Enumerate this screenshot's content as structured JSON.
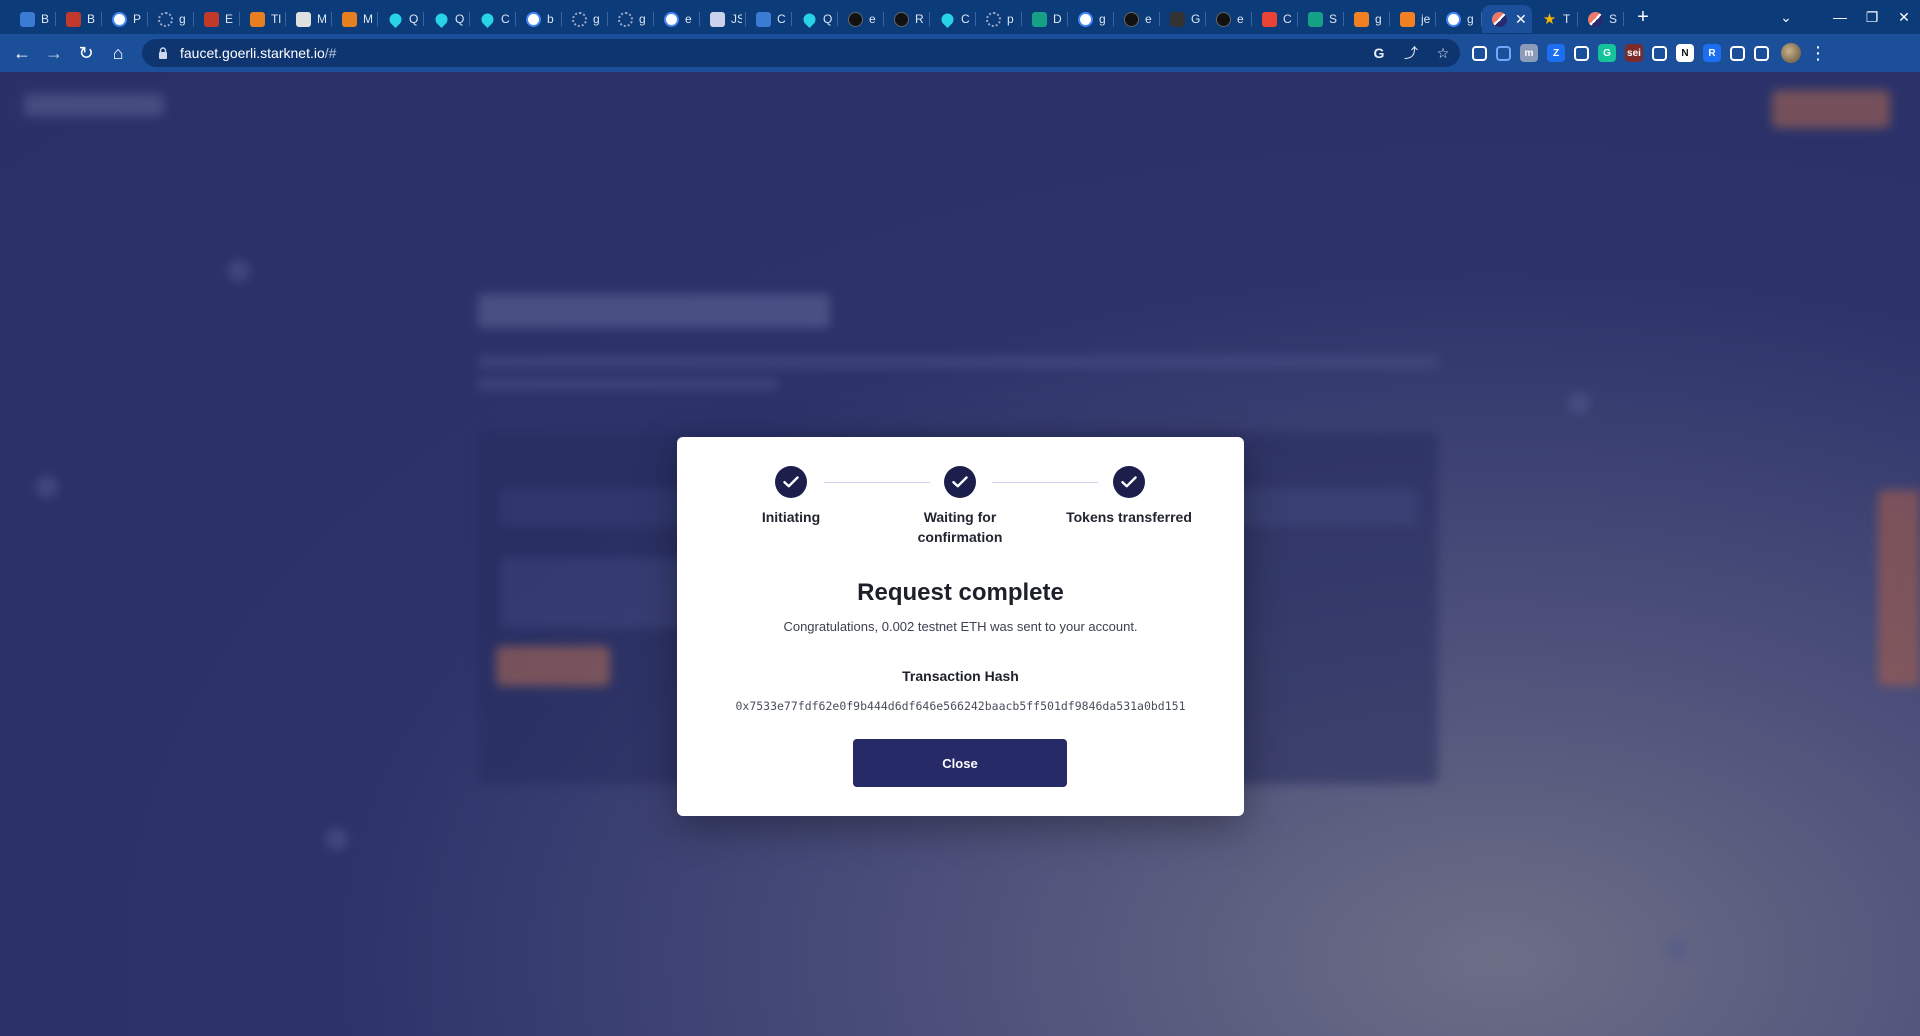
{
  "browser": {
    "tabs": [
      {
        "title": "B",
        "icon": "diamond-icon",
        "color": "#3a7bd5"
      },
      {
        "title": "B",
        "icon": "circle-icon",
        "color": "#c0392b"
      },
      {
        "title": "P",
        "icon": "google-icon",
        "color": "#ffffff"
      },
      {
        "title": "g",
        "icon": "sun-icon",
        "color": "#9aa7c7"
      },
      {
        "title": "E",
        "icon": "circle-icon",
        "color": "#c0392b"
      },
      {
        "title": "Tl",
        "icon": "fox-icon",
        "color": "#e67e22"
      },
      {
        "title": "M",
        "icon": "mail-icon",
        "color": "#e0e0e0"
      },
      {
        "title": "M",
        "icon": "fox-icon",
        "color": "#e67e22"
      },
      {
        "title": "Q",
        "icon": "drop-icon",
        "color": "#29d3e6"
      },
      {
        "title": "Q",
        "icon": "drop-icon",
        "color": "#29d3e6"
      },
      {
        "title": "C",
        "icon": "drop-icon",
        "color": "#29d3e6"
      },
      {
        "title": "b",
        "icon": "google-icon",
        "color": "#ffffff"
      },
      {
        "title": "g",
        "icon": "sun-icon",
        "color": "#9aa7c7"
      },
      {
        "title": "g",
        "icon": "sun-icon",
        "color": "#9aa7c7"
      },
      {
        "title": "e",
        "icon": "google-icon",
        "color": "#ffffff"
      },
      {
        "title": "JS",
        "icon": "ethereum-icon",
        "color": "#c9d2ea"
      },
      {
        "title": "C",
        "icon": "book-icon",
        "color": "#3a7bd5"
      },
      {
        "title": "Q",
        "icon": "drop-icon",
        "color": "#29d3e6"
      },
      {
        "title": "e",
        "icon": "github-icon",
        "color": "#111111"
      },
      {
        "title": "R",
        "icon": "github-icon",
        "color": "#111111"
      },
      {
        "title": "C",
        "icon": "drop-icon",
        "color": "#29d3e6"
      },
      {
        "title": "p",
        "icon": "sun-icon",
        "color": "#9aa7c7"
      },
      {
        "title": "D",
        "icon": "square-icon",
        "color": "#16a085"
      },
      {
        "title": "g",
        "icon": "google-icon",
        "color": "#ffffff"
      },
      {
        "title": "e",
        "icon": "github-icon",
        "color": "#111111"
      },
      {
        "title": "G",
        "icon": "square-icon",
        "color": "#333333"
      },
      {
        "title": "e",
        "icon": "github-icon",
        "color": "#111111"
      },
      {
        "title": "C",
        "icon": "gmail-icon",
        "color": "#ea4335"
      },
      {
        "title": "S",
        "icon": "square-icon",
        "color": "#16a085"
      },
      {
        "title": "g",
        "icon": "stack-icon",
        "color": "#f48024"
      },
      {
        "title": "je",
        "icon": "stack-icon",
        "color": "#f48024"
      },
      {
        "title": "g",
        "icon": "google-icon",
        "color": "#ffffff"
      },
      {
        "title": "",
        "icon": "starknet-icon",
        "color": "#ec796b",
        "active": true
      },
      {
        "title": "T",
        "icon": "star-icon",
        "color": "#f4b400"
      },
      {
        "title": "S",
        "icon": "starknet-icon",
        "color": "#ec796b"
      }
    ],
    "url_host": "faucet.goerli.starknet.io",
    "url_path": "/#",
    "tab_close_glyph": "✕",
    "new_tab_glyph": "+",
    "controls": {
      "list": "⌄",
      "minimize": "—",
      "restore": "❐",
      "close": "✕"
    },
    "nav": {
      "back": "←",
      "forward": "→",
      "reload": "↻",
      "home": "⌂"
    },
    "omnibox_icons": {
      "google": "G",
      "share": "⤴",
      "star": "☆"
    },
    "extensions": [
      {
        "icon": "wallet-icon",
        "label": "",
        "color": "#ffffff"
      },
      {
        "icon": "snake-icon",
        "label": "",
        "color": "#6ea8ff"
      },
      {
        "icon": "m-icon",
        "label": "m",
        "color": "#8c9bb8"
      },
      {
        "icon": "z-icon",
        "label": "Z",
        "color": "#1d6ff2"
      },
      {
        "icon": "paw-icon",
        "label": "",
        "color": "#ffffff"
      },
      {
        "icon": "grammarly-icon",
        "label": "G",
        "color": "#15c39a"
      },
      {
        "icon": "sei-icon",
        "label": "sei",
        "color": "#7a2c2c"
      },
      {
        "icon": "columns-icon",
        "label": "",
        "color": "#ffffff"
      },
      {
        "icon": "notion-icon",
        "label": "N",
        "color": "#ffffff"
      },
      {
        "icon": "r-icon",
        "label": "R",
        "color": "#1d6ff2"
      },
      {
        "icon": "puzzle-icon",
        "label": "",
        "color": "#ffffff"
      },
      {
        "icon": "sidepanel-icon",
        "label": "",
        "color": "#ffffff"
      }
    ]
  },
  "modal": {
    "steps": [
      {
        "label": "Initiating"
      },
      {
        "label": "Waiting for confirmation"
      },
      {
        "label": "Tokens transferred"
      }
    ],
    "title": "Request complete",
    "subtitle": "Congratulations, 0.002 testnet ETH was sent to your account.",
    "hash_label": "Transaction Hash",
    "hash_value": "0x7533e77fdf62e0f9b444d6df646e566242baacb5ff501df9846da531a0bd151",
    "close_label": "Close"
  },
  "colors": {
    "accent": "#262a66",
    "step_done": "#1c1f4b",
    "tabstrip": "#0b3b78",
    "toolbar": "#1b4f9a"
  }
}
